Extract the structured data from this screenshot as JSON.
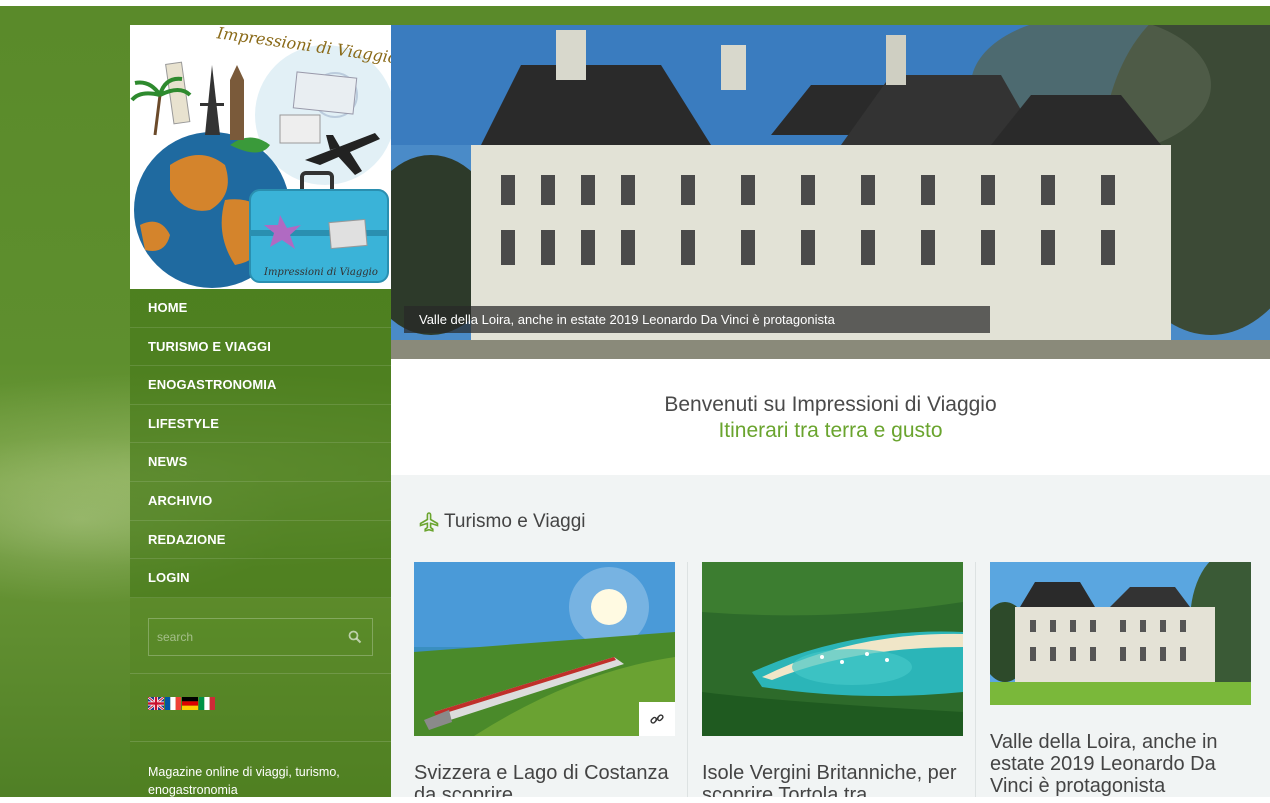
{
  "logo": {
    "top_text": "Impressioni di Viaggio",
    "luggage_text": "Impressioni di Viaggio",
    "icon": "travel-logo-icon"
  },
  "nav": {
    "items": [
      {
        "label": "HOME"
      },
      {
        "label": "TURISMO E VIAGGI"
      },
      {
        "label": "ENOGASTRONOMIA"
      },
      {
        "label": "LIFESTYLE"
      },
      {
        "label": "NEWS"
      },
      {
        "label": "ARCHIVIO"
      },
      {
        "label": "REDAZIONE"
      },
      {
        "label": "LOGIN"
      }
    ]
  },
  "search": {
    "placeholder": "search",
    "icon": "search-icon"
  },
  "languages": [
    {
      "code": "en",
      "icon": "uk-flag-icon"
    },
    {
      "code": "fr",
      "icon": "france-flag-icon"
    },
    {
      "code": "de",
      "icon": "germany-flag-icon"
    },
    {
      "code": "it",
      "icon": "italy-flag-icon"
    }
  ],
  "tagline": "Magazine online di viaggi, turismo, enogastronomia",
  "hero": {
    "caption": "Valle della Loira, anche in estate 2019 Leonardo Da Vinci è protagonista"
  },
  "welcome": {
    "title": "Benvenuti su Impressioni di Viaggio",
    "subtitle": "Itinerari tra terra e gusto"
  },
  "section": {
    "title": "Turismo e Viaggi",
    "icon": "airplane-icon"
  },
  "cards": [
    {
      "title": "Svizzera e Lago di Costanza da scoprire",
      "image": "train-lake-photo"
    },
    {
      "title": "Isole Vergini Britanniche, per scoprire Tortola tra",
      "image": "tropical-bay-photo"
    },
    {
      "title": "Valle della Loira, anche in estate 2019 Leonardo Da Vinci è protagonista",
      "image": "chateau-photo"
    }
  ],
  "colors": {
    "accent_green": "#6aa42e",
    "page_green": "#5a8a2a",
    "text_dark": "#444444"
  }
}
